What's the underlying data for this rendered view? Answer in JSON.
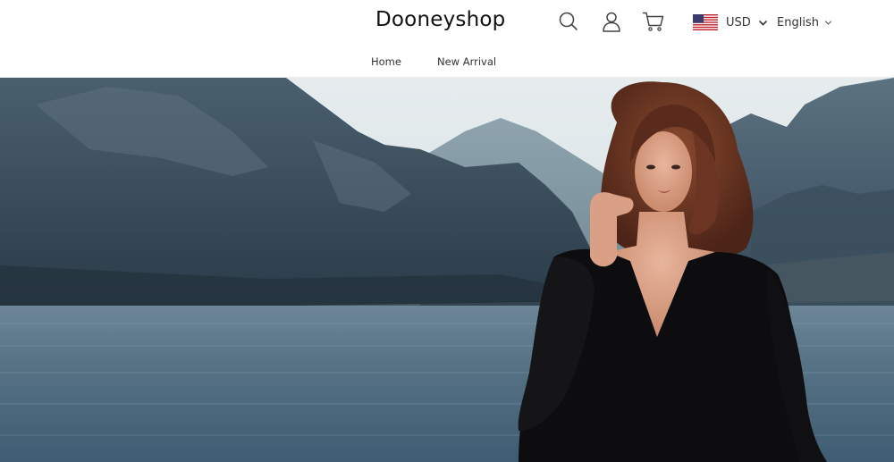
{
  "header": {
    "logo_text": "Dooneyshop",
    "icons": {
      "search": "search-icon",
      "account": "user-icon",
      "cart": "cart-icon"
    },
    "currency": {
      "flag": "us-flag-icon",
      "label": "USD"
    },
    "language": {
      "label": "English"
    }
  },
  "nav": {
    "items": [
      {
        "label": "Home"
      },
      {
        "label": "New Arrival"
      }
    ]
  },
  "hero": {
    "image": "lake-mountains-woman-black-dress",
    "colors": {
      "sky": "#dfe7ea",
      "mountain_dark": "#2f4150",
      "water": "#4f6f86",
      "dress": "#0c0c0e",
      "hair": "#6a3322"
    }
  }
}
